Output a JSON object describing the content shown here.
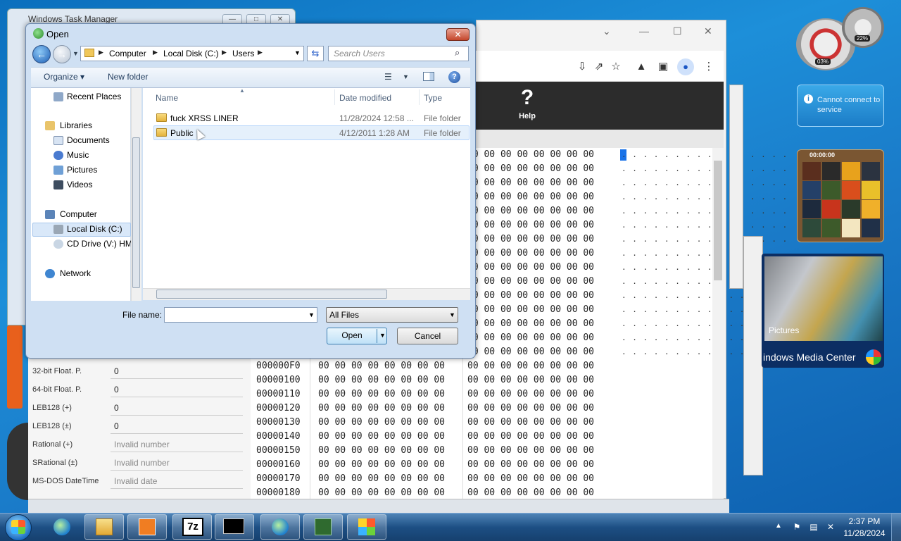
{
  "taskmgr": {
    "title": "Windows Task Manager"
  },
  "browser": {
    "help_label": "Help",
    "help_glyph": "?"
  },
  "hex": {
    "addresses": [
      "000000F0",
      "00000100",
      "00000110",
      "00000120",
      "00000130",
      "00000140",
      "00000150",
      "00000160",
      "00000170",
      "00000180"
    ],
    "left_bytes": "00 00 00 00 00 00 00 00",
    "right_bytes": "00 00 00 00 00 00 00 00",
    "right_bytes_upper": "00 00 00 00 00 00 00 00",
    "dots": ". . . . . . . . . . . . . . . ."
  },
  "inspector": {
    "rows": [
      {
        "label": "32-bit Float. P.",
        "value": "0"
      },
      {
        "label": "64-bit Float. P.",
        "value": "0"
      },
      {
        "label": "LEB128 (+)",
        "value": "0"
      },
      {
        "label": "LEB128 (±)",
        "value": "0"
      },
      {
        "label": "Rational (+)",
        "value": "Invalid number"
      },
      {
        "label": "SRational (±)",
        "value": "Invalid number"
      },
      {
        "label": "MS-DOS DateTime",
        "value": "Invalid date"
      }
    ]
  },
  "gadgets": {
    "cpu_pct": "03%",
    "mem_pct": "22%",
    "service_msg": "Cannot connect to service",
    "puzzle_time": "00:00:00",
    "wmc_pictures": "Pictures",
    "wmc_title": "indows Media Center"
  },
  "dialog": {
    "title": "Open",
    "close": "✕",
    "breadcrumbs": [
      "Computer",
      "Local Disk (C:)",
      "Users"
    ],
    "search_placeholder": "Search Users",
    "toolbar": {
      "organize": "Organize ▾",
      "new_folder": "New folder"
    },
    "nav": {
      "recent": "Recent Places",
      "libraries": "Libraries",
      "documents": "Documents",
      "music": "Music",
      "pictures": "Pictures",
      "videos": "Videos",
      "computer": "Computer",
      "local_disk": "Local Disk (C:)",
      "cd_drive": "CD Drive (V:) HM",
      "network": "Network"
    },
    "columns": {
      "name": "Name",
      "date": "Date modified",
      "type": "Type"
    },
    "files": [
      {
        "name": "fuck XRSS LINER",
        "date": "11/28/2024 12:58 ...",
        "type": "File folder"
      },
      {
        "name": "Public",
        "date": "4/12/2011 1:28 AM",
        "type": "File folder"
      }
    ],
    "file_name_label": "File name:",
    "file_name_value": "",
    "file_type": "All Files",
    "open_label": "Open",
    "cancel_label": "Cancel"
  },
  "taskbar": {
    "clock_time": "2:37 PM",
    "clock_date": "11/28/2024",
    "items": [
      "ie-icon",
      "explorer-icon",
      "media-player-icon",
      "7zip-icon",
      "cmd-icon",
      "ie-icon-2",
      "network-monitor-icon",
      "windows-flag-icon"
    ],
    "sevenzip_label": "7z"
  }
}
